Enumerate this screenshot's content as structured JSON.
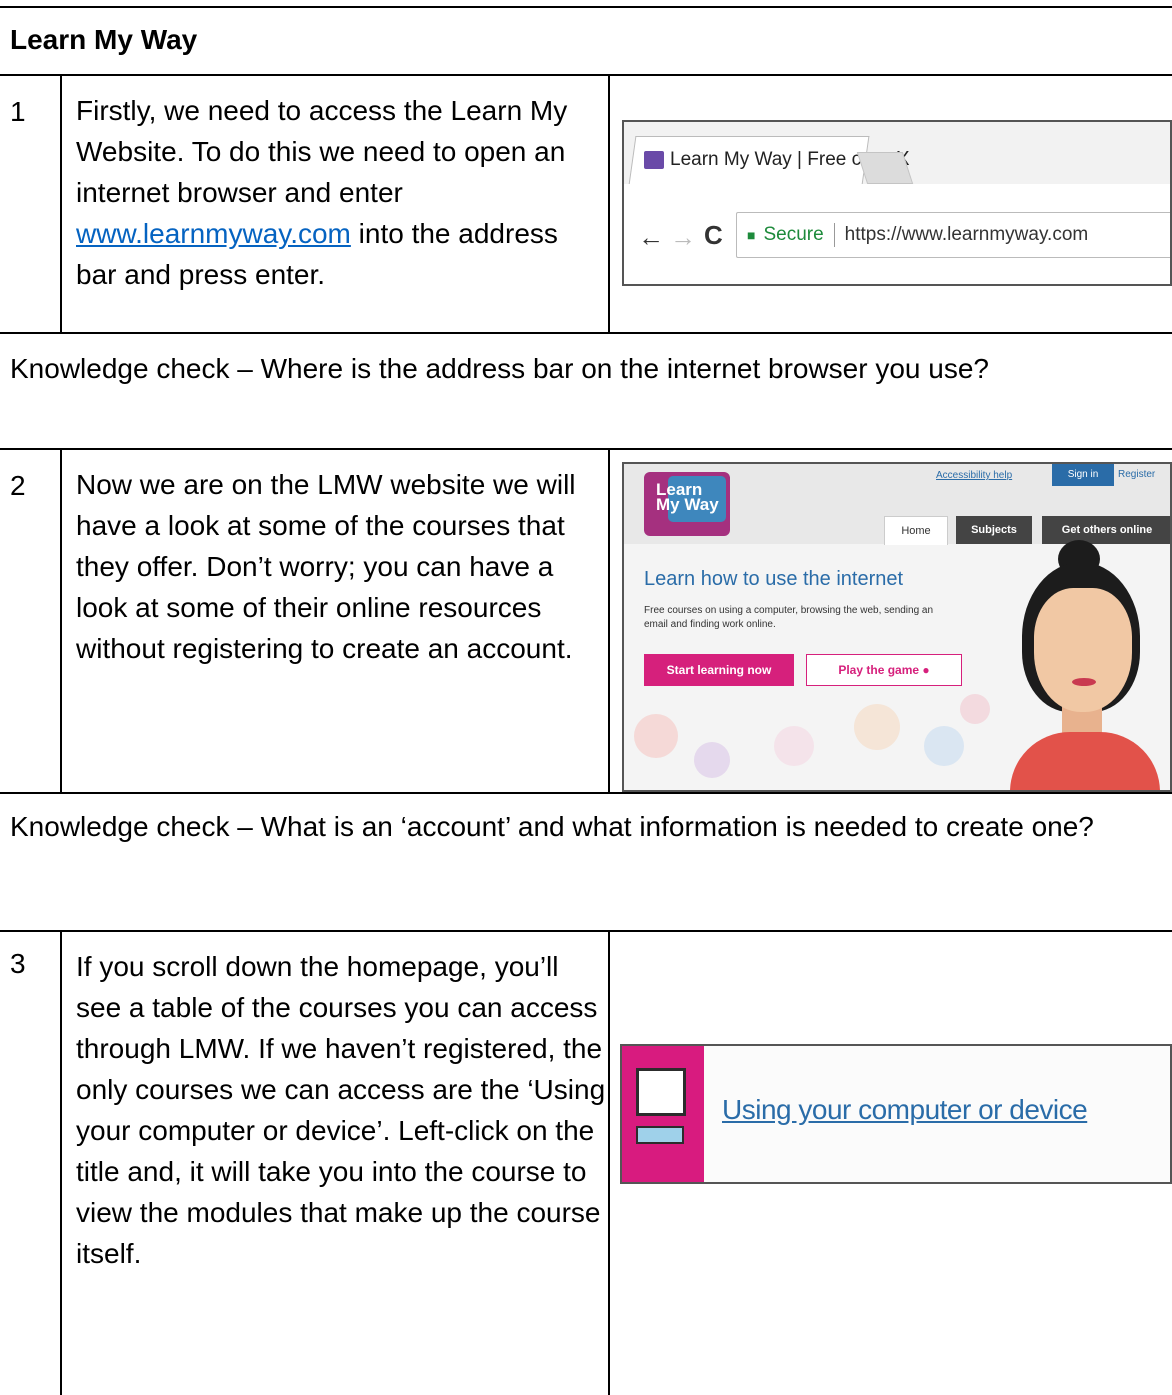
{
  "title": "Learn My Way",
  "steps": [
    {
      "num": "1",
      "text_before": "Firstly, we need to access the Learn My Website. To do this we need to open an internet browser and enter ",
      "link": "www.learnmyway.com",
      "text_after": " into the address bar and press enter."
    },
    {
      "num": "2",
      "text": "Now we are on the LMW website we will have a look at some of the courses that they offer. Don’t worry; you can have a look at some of their online resources without registering to create an account."
    },
    {
      "num": "3",
      "text": "If you scroll down the homepage, you’ll see a table of the courses you can access through LMW. If we haven’t registered, the only courses we can access are the ‘Using your computer or device’. Left-click on the title and, it will take you into the course to view the modules that make up the course itself."
    }
  ],
  "knowledge_checks": [
    "Knowledge check – Where is the address bar on the internet browser you use?",
    "Knowledge check – What is an ‘account’ and what information is needed to create one?"
  ],
  "browser": {
    "tab_title": "Learn My Way | Free cou",
    "tab_close": "X",
    "back_icon": "←",
    "forward_icon": "→",
    "reload_icon": "C",
    "secure_label": "Secure",
    "url": "https://www.learnmyway.com"
  },
  "lmw": {
    "logo_text": "Learn My Way",
    "accessibility": "Accessibility help",
    "sign_in": "Sign in",
    "register": "Register",
    "tabs": [
      "Home",
      "Subjects",
      "Get others online"
    ],
    "hero_title": "Learn how to use the internet",
    "hero_sub": "Free courses on using a computer, browsing the web, sending an email and finding work online.",
    "start_button": "Start learning now",
    "play_button": "Play the game ●"
  },
  "course": {
    "link": "Using your computer or device"
  },
  "colors": {
    "link_blue": "#0563c1",
    "lmw_pink": "#d6207c",
    "lmw_blue": "#2a6ca8"
  }
}
